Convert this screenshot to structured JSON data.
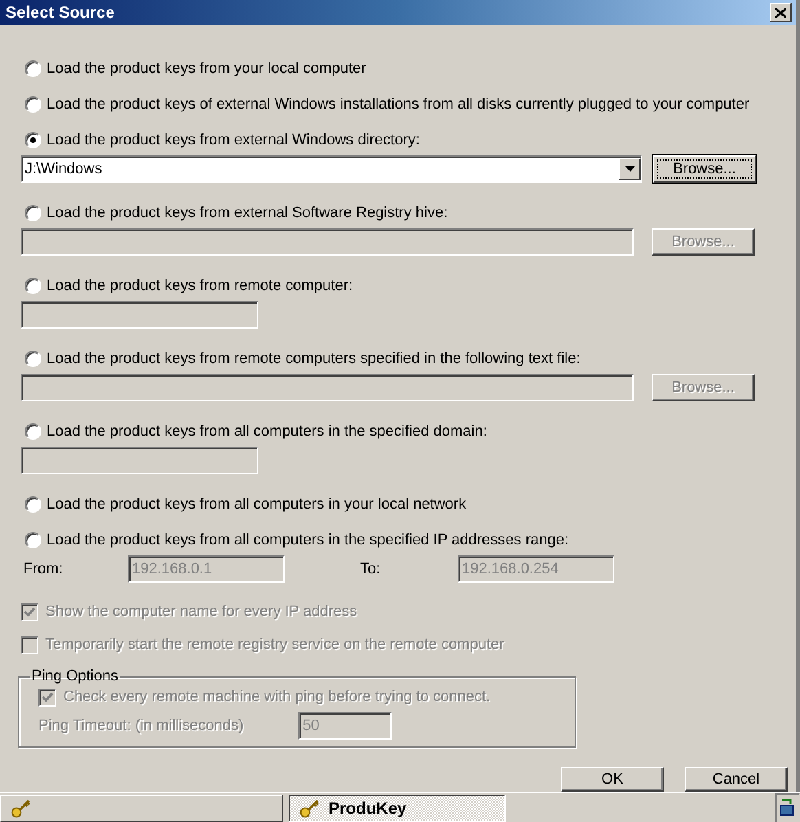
{
  "window": {
    "title": "Select Source"
  },
  "sources": [
    {
      "kind": "plain",
      "label": "Load the product keys from your local computer",
      "selected": false
    },
    {
      "kind": "plain",
      "label": "Load the product keys of external Windows installations from all disks currently plugged to your computer",
      "selected": false
    },
    {
      "kind": "combo",
      "label": "Load the product keys from external Windows directory:",
      "selected": true,
      "value": "J:\\Windows",
      "browse": "Browse..."
    },
    {
      "kind": "path",
      "label": "Load the product keys from external Software Registry hive:",
      "selected": false,
      "browse": "Browse..."
    },
    {
      "kind": "text",
      "label": "Load the product keys from remote computer:",
      "selected": false
    },
    {
      "kind": "path",
      "label": "Load the product keys from remote computers specified in the following text file:",
      "selected": false,
      "browse": "Browse..."
    },
    {
      "kind": "text",
      "label": "Load the product keys from all computers in the specified domain:",
      "selected": false
    },
    {
      "kind": "plain",
      "label": "Load the product keys from all computers in your local network",
      "selected": false
    },
    {
      "kind": "range",
      "label": "Load the product keys from all computers in the specified IP addresses range:",
      "selected": false,
      "from_label": "From:",
      "from": "192.168.0.1",
      "to_label": "To:",
      "to": "192.168.0.254"
    }
  ],
  "checkboxes": [
    {
      "label": "Show the computer name for every IP address",
      "checked": true,
      "disabled": true
    },
    {
      "label": "Temporarily start the remote registry service on the remote computer",
      "checked": false,
      "disabled": true
    }
  ],
  "ping_options": {
    "title": "Ping Options",
    "check": {
      "label": "Check every remote machine with ping before trying to connect.",
      "checked": true,
      "disabled": true
    },
    "timeout_label": "Ping Timeout: (in milliseconds)",
    "timeout": "50"
  },
  "buttons": [
    "OK",
    "Cancel"
  ],
  "taskbar": {
    "items": [
      {
        "selected": false
      },
      {
        "label": "ProduKey",
        "selected": true
      }
    ]
  }
}
